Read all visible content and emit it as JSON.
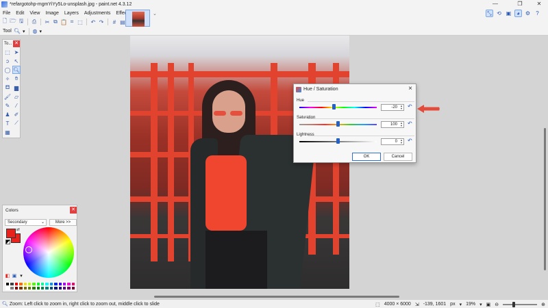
{
  "window": {
    "title": "*refargotohp-mgmYiYy5Lo-unsplash.jpg - paint.net 4.3.12",
    "controls": [
      "—",
      "❐",
      "✕"
    ]
  },
  "menu": [
    "File",
    "Edit",
    "View",
    "Image",
    "Layers",
    "Adjustments",
    "Effects"
  ],
  "toolbar": {
    "tool_label": "Tool"
  },
  "tools_panel": {
    "title": "To..."
  },
  "colors_panel": {
    "title": "Colors",
    "mode": "Secondary",
    "more_button": "More >>",
    "primary_color": "#e8231e",
    "secondary_color": "#e8231e",
    "palette": [
      "#000000",
      "#404040",
      "#ff0000",
      "#ff6a00",
      "#ffd800",
      "#b6ff00",
      "#4cff00",
      "#00ff21",
      "#00ff90",
      "#00ffff",
      "#0094ff",
      "#0026ff",
      "#4800ff",
      "#b200ff",
      "#ff00dc",
      "#ff006e",
      "#ffffff",
      "#808080",
      "#7f0000",
      "#7f3300",
      "#7f6a00",
      "#5b7f00",
      "#267f00",
      "#007f0e",
      "#007f46",
      "#007f7f",
      "#004a7f",
      "#00137f",
      "#21007f",
      "#57007f",
      "#7f006e",
      "#7f0037"
    ]
  },
  "dialog": {
    "title": "Hue / Saturation",
    "hue": {
      "label": "Hue",
      "value": "-20",
      "min": -180,
      "max": 180
    },
    "saturation": {
      "label": "Saturation",
      "value": "100",
      "min": 0,
      "max": 200
    },
    "lightness": {
      "label": "Lightness",
      "value": "0",
      "min": -100,
      "max": 100
    },
    "ok_label": "OK",
    "cancel_label": "Cancel"
  },
  "statusbar": {
    "hint": "Zoom: Left click to zoom in, right click to zoom out, middle click to slide",
    "image_size": "4000 × 6000",
    "cursor_pos": "-139, 1601",
    "units": "px",
    "zoom": "19%"
  },
  "accent_color": "#2560c4",
  "annotation_color": "#e34b3c"
}
